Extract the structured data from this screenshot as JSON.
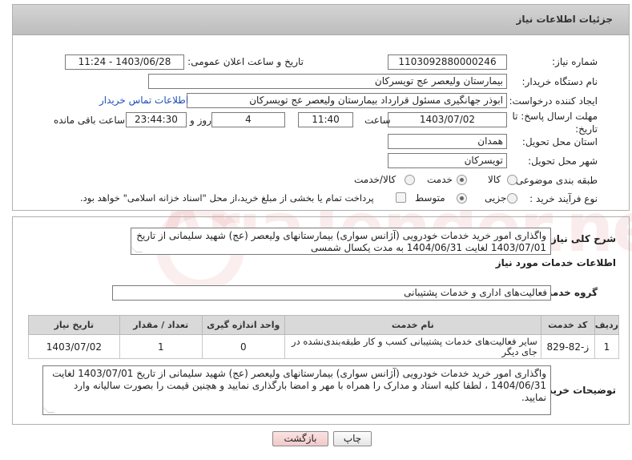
{
  "header": {
    "title": "جزئیات اطلاعات نیاز"
  },
  "form": {
    "need_number": {
      "label": "شماره نیاز:",
      "value": "1103092880000246"
    },
    "announce": {
      "label": "تاریخ و ساعت اعلان عمومی:",
      "value": "1403/06/28 - 11:24"
    },
    "buyer": {
      "label": "نام دستگاه خریدار:",
      "value": "بیمارستان ولیعصر  عج  تویسرکان"
    },
    "creator": {
      "label": "ایجاد کننده درخواست:",
      "value": "ابوذر جهانگیری مسئول قرارداد بیمارستان ولیعصر  عج  تویسرکان",
      "contact_link": "اطلاعات تماس خریدار"
    },
    "deadline": {
      "label": "مهلت ارسال پاسخ: تا تاریخ:",
      "date": "1403/07/02",
      "time_label": "ساعت",
      "time": "11:40",
      "days": "4",
      "days_label": "روز و",
      "remaining": "23:44:30",
      "remaining_label": "ساعت باقی مانده"
    },
    "province": {
      "label": "استان محل تحویل:",
      "value": "همدان"
    },
    "city": {
      "label": "شهر محل تحویل:",
      "value": "تویسرکان"
    },
    "category": {
      "label": "طبقه بندی موضوعی:",
      "options": [
        "کالا",
        "خدمت",
        "کالا/خدمت"
      ],
      "selected": "خدمت"
    },
    "process": {
      "label": "نوع فرآیند خرید :",
      "options": [
        "جزیی",
        "متوسط"
      ],
      "selected": "متوسط",
      "payment_note": "پرداخت تمام یا بخشی از مبلغ خرید،از محل \"اسناد خزانه اسلامی\" خواهد بود."
    }
  },
  "summary": {
    "label": "شرح کلی نیاز:",
    "text": "واگذاری امور خرید خدمات خودرویی (آژانس سواری) بیمارستانهای ولیعصر (عج) شهید سلیمانی از تاریخ 1403/07/01 لغایت 1404/06/31 به مدت یکسال شمسی"
  },
  "services": {
    "section_title": "اطلاعات خدمات مورد نیاز",
    "group_label": "گروه خدمت:",
    "group_value": "فعالیت‌های اداری و خدمات پشتیبانی",
    "columns": [
      "ردیف",
      "کد خدمت",
      "نام خدمت",
      "واحد اندازه گیری",
      "تعداد / مقدار",
      "تاریخ نیاز"
    ],
    "rows": [
      {
        "row": "1",
        "code": "ز-82-829",
        "name": "سایر فعالیت‌های خدمات پشتیبانی کسب و کار طبقه‌بندی‌نشده در جای دیگر",
        "unit": "0",
        "qty": "1",
        "date": "1403/07/02"
      }
    ]
  },
  "buyer_notes": {
    "label": "توضیحات خریدار:",
    "text": "واگذاری امور خرید خدمات خودرویی (آژانس سواری) بیمارستانهای ولیعصر (عج) شهید سلیمانی از تاریخ 1403/07/01 لغایت 1404/06/31 ، لطفا کلیه اسناد و مدارک را همراه با مهر و امضا بارگذاری نمایید و هچنین قیمت را بصورت سالیانه وارد نمایید."
  },
  "buttons": {
    "print": "چاپ",
    "back": "بازگشت"
  },
  "colors": {
    "back_button_bg": "#f6d6d6",
    "link": "#1f4fb5"
  }
}
